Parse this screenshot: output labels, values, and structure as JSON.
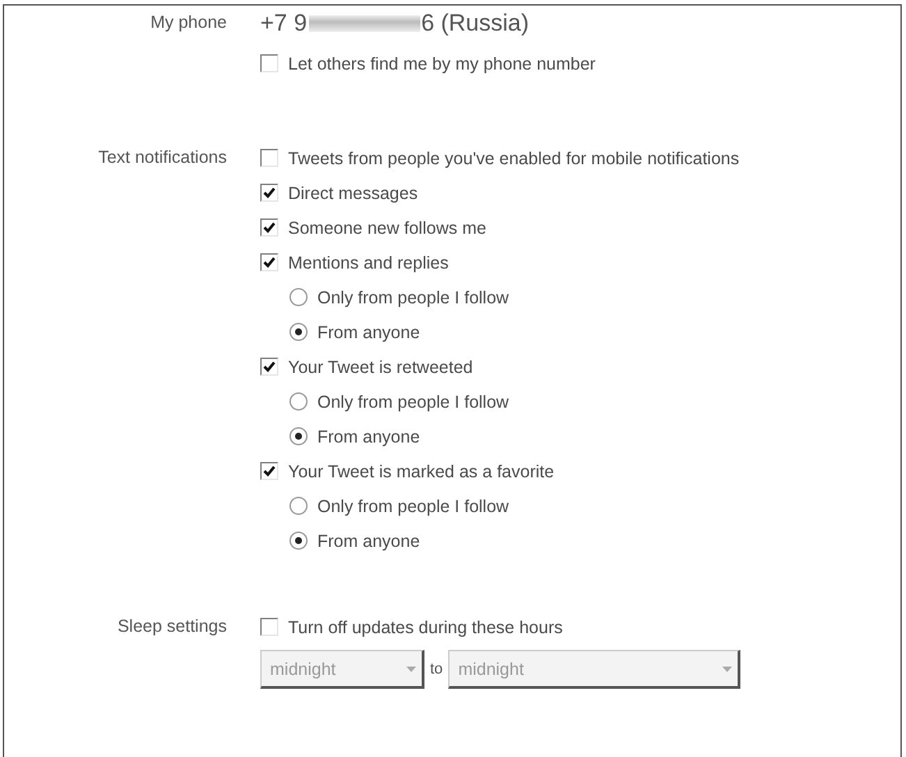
{
  "sections": [
    {
      "label": "My phone",
      "phone": {
        "start": "+7 9",
        "end": "6 (Russia)"
      },
      "options": [
        {
          "kind": "checkbox",
          "label": "Let others find me by my phone number",
          "checked": false
        }
      ]
    },
    {
      "label": "Text notifications",
      "options": [
        {
          "kind": "checkbox",
          "label": "Tweets from people you've enabled for mobile notifications",
          "checked": false
        },
        {
          "kind": "checkbox",
          "label": "Direct messages",
          "checked": true
        },
        {
          "kind": "checkbox",
          "label": "Someone new follows me",
          "checked": true
        },
        {
          "kind": "checkbox",
          "label": "Mentions and replies",
          "checked": true,
          "children": [
            {
              "kind": "radio",
              "label": "Only from people I follow",
              "selected": false
            },
            {
              "kind": "radio",
              "label": "From anyone",
              "selected": true
            }
          ]
        },
        {
          "kind": "checkbox",
          "label": "Your Tweet is retweeted",
          "checked": true,
          "children": [
            {
              "kind": "radio",
              "label": "Only from people I follow",
              "selected": false
            },
            {
              "kind": "radio",
              "label": "From anyone",
              "selected": true
            }
          ]
        },
        {
          "kind": "checkbox",
          "label": "Your Tweet is marked as a favorite",
          "checked": true,
          "children": [
            {
              "kind": "radio",
              "label": "Only from people I follow",
              "selected": false
            },
            {
              "kind": "radio",
              "label": "From anyone",
              "selected": true
            }
          ]
        }
      ]
    },
    {
      "label": "Sleep settings",
      "options": [
        {
          "kind": "checkbox",
          "label": "Turn off updates during these hours",
          "checked": false
        }
      ],
      "hours": {
        "from": {
          "value": "midnight",
          "disabled": true
        },
        "separator": "to",
        "to": {
          "value": "midnight",
          "disabled": true
        }
      }
    }
  ]
}
